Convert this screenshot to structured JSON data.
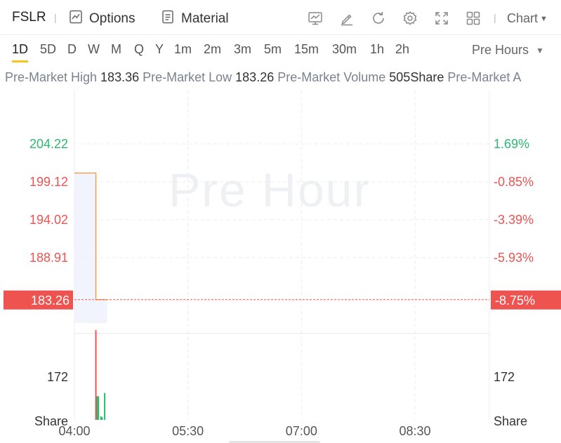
{
  "toolbar": {
    "ticker": "FSLR",
    "options_label": "Options",
    "material_label": "Material",
    "chart_label": "Chart",
    "icons": [
      "indicator-icon",
      "draw-icon",
      "refresh-icon",
      "settings-icon",
      "fullscreen-icon",
      "layout-icon"
    ]
  },
  "periods": [
    "1D",
    "5D",
    "D",
    "W",
    "M",
    "Q",
    "Y",
    "1m",
    "2m",
    "3m",
    "5m",
    "15m",
    "30m",
    "1h",
    "2h"
  ],
  "active_period": "1D",
  "session_selector": "Pre Hours",
  "info": {
    "high_label": "Pre-Market High",
    "high_value": "183.36",
    "low_label": "Pre-Market Low",
    "low_value": "183.26",
    "volume_label": "Pre-Market Volume",
    "volume_value": "505Share",
    "truncated_label": "Pre-Market A"
  },
  "watermark": "Pre Hour",
  "colors": {
    "up": "#2db86f",
    "down": "#ef5350",
    "line": "#f39a4a",
    "grid": "#eceef2"
  },
  "chart_data": {
    "type": "line",
    "price_axis": {
      "ticks": [
        "204.22",
        "199.12",
        "194.02",
        "188.91"
      ],
      "tick_values": [
        204.22,
        199.12,
        194.02,
        188.91
      ],
      "current": "183.26",
      "current_value": 183.26
    },
    "percent_axis": {
      "ticks": [
        "1.69%",
        "-0.85%",
        "-3.39%",
        "-5.93%"
      ],
      "current": "-8.75%"
    },
    "volume_axis": {
      "ticks": [
        "172"
      ],
      "unit": "Share"
    },
    "time_axis": [
      "04:00",
      "05:30",
      "07:00",
      "08:30"
    ],
    "price_series": [
      {
        "t": "04:00",
        "price": 200.3
      },
      {
        "t": "04:17",
        "price": 200.3
      },
      {
        "t": "04:17",
        "price": 183.26
      },
      {
        "t": "04:26",
        "price": 183.26
      }
    ],
    "volume_bars": [
      {
        "t": "04:17",
        "volume": 360,
        "dir": "down"
      },
      {
        "t": "04:18",
        "volume": 95,
        "dir": "up"
      },
      {
        "t": "04:19",
        "volume": 95,
        "dir": "up"
      },
      {
        "t": "04:21",
        "volume": 14,
        "dir": "up"
      },
      {
        "t": "04:22",
        "volume": 10,
        "dir": "up"
      },
      {
        "t": "04:24",
        "volume": 108,
        "dir": "up"
      }
    ]
  }
}
